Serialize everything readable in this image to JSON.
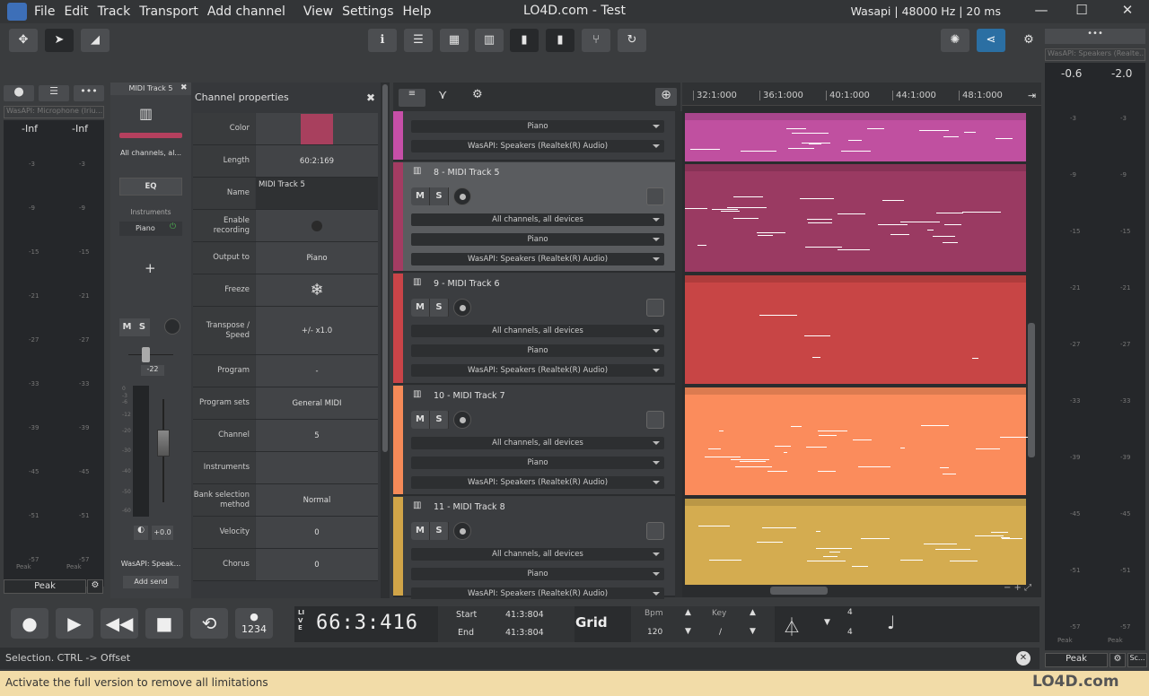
{
  "window": {
    "title": "LO4D.com - Test",
    "audio_status": "Wasapi | 48000 Hz | 20 ms",
    "minimize": "—",
    "maximize": "☐",
    "close": "✕"
  },
  "menu": [
    "File",
    "Edit",
    "Track",
    "Transport",
    "Add channel",
    "View",
    "Settings",
    "Help"
  ],
  "toolbar": {
    "left_icons": [
      "move-icon",
      "pointer-icon",
      "ramp-icon"
    ],
    "center_icons": [
      "info-icon",
      "mixer-icon",
      "grid-icon",
      "piano-icon",
      "fader-record-icon",
      "fader-play-icon",
      "tuning-fork-icon",
      "loop-icon"
    ],
    "right_icons": [
      "network-icon",
      "share-icon",
      "gear-icon"
    ]
  },
  "input_meter": {
    "device": "WasAPI: Microphone (Iriu...",
    "left_value": "-Inf",
    "right_value": "-Inf",
    "ticks": [
      "-3",
      "-9",
      "-15",
      "-21",
      "-27",
      "-33",
      "-39",
      "-45",
      "-51",
      "-57"
    ],
    "peak_label": "Peak",
    "foot_left": "Peak",
    "foot_right": "Peak"
  },
  "channel_strip": {
    "title": "MIDI Track 5",
    "input": "All channels, al...",
    "eq": "EQ",
    "instruments_label": "Instruments",
    "instrument": "Piano",
    "add": "+",
    "mute": "M",
    "solo": "S",
    "pan_value": "-22",
    "scale": [
      "0",
      "-3",
      "-6",
      "-12",
      "-20",
      "-30",
      "-40",
      "-50",
      "-60"
    ],
    "gain": "+0.0",
    "output": "WasAPI: Speak...",
    "add_send": "Add send",
    "color": "#b5405e"
  },
  "channel_properties": {
    "title": "Channel properties",
    "rows": [
      {
        "label": "Color",
        "value": ""
      },
      {
        "label": "Length",
        "value": "60:2:169"
      },
      {
        "label": "Name",
        "value": "MIDI Track 5"
      },
      {
        "label": "Enable recording",
        "value": ""
      },
      {
        "label": "Output to",
        "value": "Piano"
      },
      {
        "label": "Freeze",
        "value": "❄"
      },
      {
        "label": "Transpose / Speed",
        "value": "+/-   x1.0"
      },
      {
        "label": "Program",
        "value": "-"
      },
      {
        "label": "Program sets",
        "value": "General MIDI"
      },
      {
        "label": "Channel",
        "value": "5"
      },
      {
        "label": "Instruments",
        "value": ""
      },
      {
        "label": "Bank selection method",
        "value": "Normal"
      },
      {
        "label": "Velocity",
        "value": "0"
      },
      {
        "label": "Chorus",
        "value": "0"
      }
    ],
    "color_swatch": "#a8405e"
  },
  "tracks": [
    {
      "name": "",
      "color": "#c64fa8",
      "clip": "#c050a0",
      "input": "",
      "instrument": "Piano",
      "output": "WasAPI: Speakers (Realtek(R) Audio)"
    },
    {
      "name": "8 - MIDI Track 5",
      "color": "#a33c62",
      "clip": "#9a3a62",
      "input": "All channels, all devices",
      "instrument": "Piano",
      "output": "WasAPI: Speakers (Realtek(R) Audio)"
    },
    {
      "name": "9 - MIDI Track 6",
      "color": "#c94448",
      "clip": "#c84545",
      "input": "All channels, all devices",
      "instrument": "Piano",
      "output": "WasAPI: Speakers (Realtek(R) Audio)"
    },
    {
      "name": "10 - MIDI Track 7",
      "color": "#f58a58",
      "clip": "#fb8c5c",
      "input": "All channels, all devices",
      "instrument": "Piano",
      "output": "WasAPI: Speakers (Realtek(R) Audio)"
    },
    {
      "name": "11 - MIDI Track 8",
      "color": "#d0a448",
      "clip": "#d4ac50",
      "input": "All channels, all devices",
      "instrument": "Piano",
      "output": "WasAPI: Speakers (Realtek(R) Audio)"
    }
  ],
  "track_buttons": {
    "mute": "M",
    "solo": "S"
  },
  "timeline": [
    "32:1:000",
    "36:1:000",
    "40:1:000",
    "44:1:000",
    "48:1:000"
  ],
  "output_meter": {
    "menu": "•••",
    "device": "WasAPI: Speakers (Realte...",
    "left_value": "-0.6",
    "right_value": "-2.0",
    "ticks": [
      "-3",
      "-9",
      "-15",
      "-21",
      "-27",
      "-33",
      "-39",
      "-45",
      "-51",
      "-57",
      "-67"
    ],
    "peak_label": "Peak",
    "settings": "Sc...",
    "foot_left": "Peak",
    "foot_right": "Peak"
  },
  "transport": {
    "live": "LIVE",
    "time": "66:3:416",
    "start_label": "Start",
    "start": "41:3:804",
    "end_label": "End",
    "end": "41:3:804",
    "grid": "Grid",
    "bpm_label": "Bpm",
    "bpm": "120",
    "key_label": "Key",
    "key": "/",
    "sig_num": "4",
    "sig_den": "4",
    "play_count": "1234"
  },
  "status": {
    "text": "Selection. CTRL -> Offset"
  },
  "banner": {
    "text": "Activate the full version to remove all limitations",
    "logo": "LO4D.com"
  }
}
